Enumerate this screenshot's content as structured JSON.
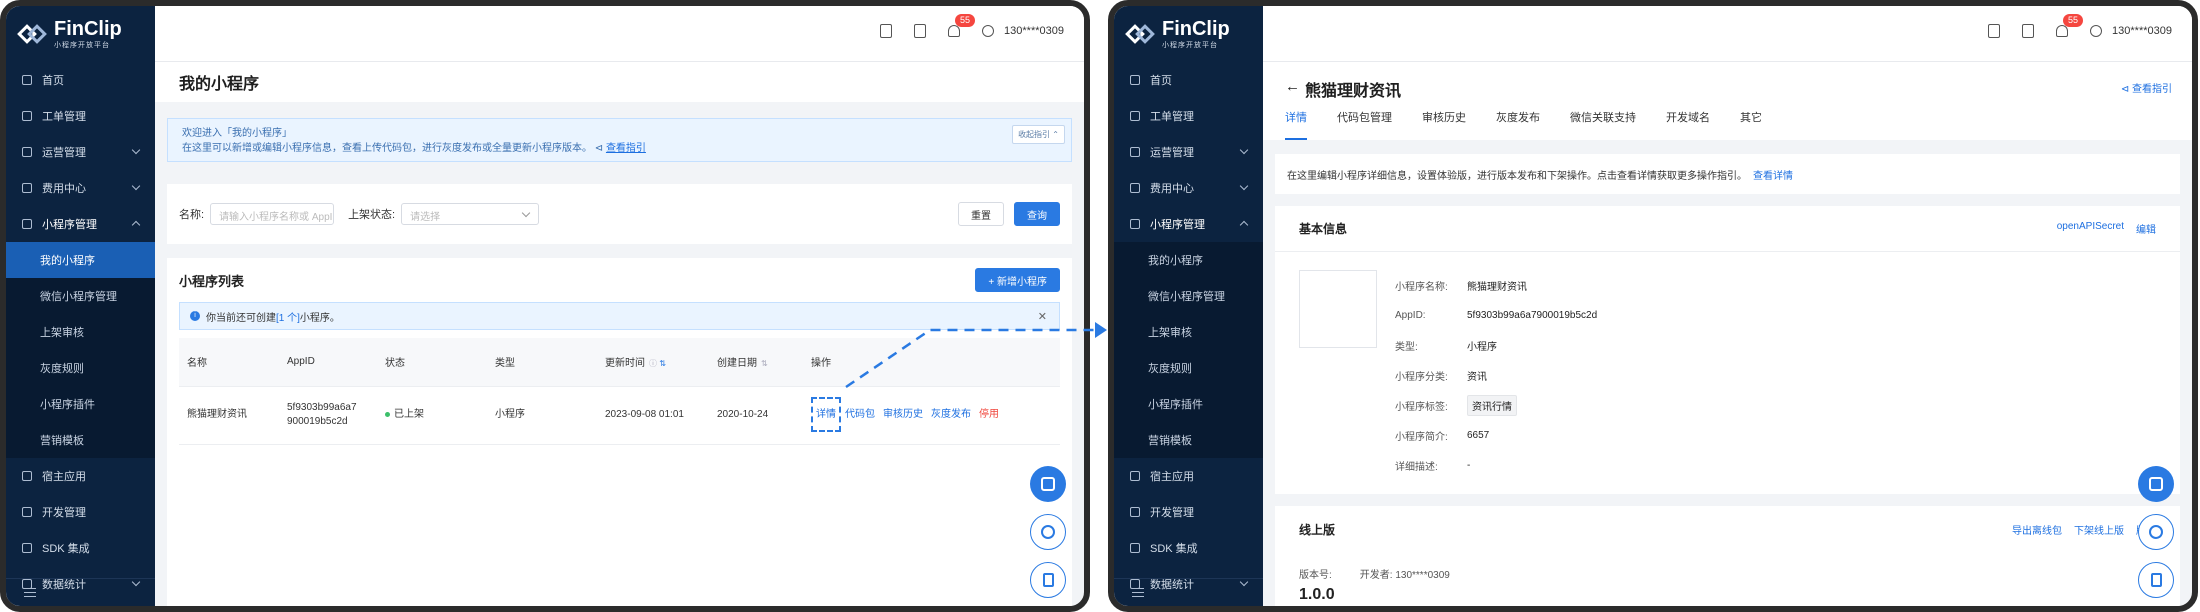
{
  "brand": {
    "title": "FinClip",
    "subtitle": "小程序开放平台"
  },
  "header": {
    "badge_count": "55",
    "user": "130****0309"
  },
  "sidebar": {
    "items": [
      {
        "label": "首页"
      },
      {
        "label": "工单管理"
      },
      {
        "label": "运营管理"
      },
      {
        "label": "费用中心"
      },
      {
        "label": "小程序管理"
      }
    ],
    "sub_items": [
      {
        "label": "我的小程序"
      },
      {
        "label": "微信小程序管理"
      },
      {
        "label": "上架审核"
      },
      {
        "label": "灰度规则"
      },
      {
        "label": "小程序插件"
      },
      {
        "label": "营销模板"
      }
    ],
    "bottom_items": [
      {
        "label": "宿主应用"
      },
      {
        "label": "开发管理"
      },
      {
        "label": "SDK 集成"
      },
      {
        "label": "数据统计"
      }
    ]
  },
  "left_page": {
    "title": "我的小程序",
    "alert_line1": "欢迎进入「我的小程序」",
    "alert_line2": "在这里可以新增或编辑小程序信息，查看上传代码包，进行灰度发布或全量更新小程序版本。",
    "alert_link": "查看指引",
    "collapse": "收起指引",
    "filter": {
      "name_label": "名称:",
      "name_placeholder": "请输入小程序名称或 AppID",
      "status_label": "上架状态:",
      "status_placeholder": "请选择",
      "reset": "重置",
      "query": "查询"
    },
    "list_title": "小程序列表",
    "add_button": "+ 新增小程序",
    "info_prefix": "你当前还可创建",
    "info_count": "[1 个]",
    "info_suffix": "小程序。",
    "columns": [
      "名称",
      "AppID",
      "状态",
      "类型",
      "更新时间",
      "创建日期",
      "操作"
    ],
    "row": {
      "name": "熊猫理财资讯",
      "appid_line1": "5f9303b99a6a7",
      "appid_line2": "900019b5c2d",
      "status": "已上架",
      "type": "小程序",
      "updated": "2023-09-08 01:01",
      "created": "2020-10-24",
      "ops": [
        "详情",
        "代码包",
        "审核历史",
        "灰度发布",
        "停用"
      ]
    }
  },
  "right_page": {
    "title": "熊猫理财资讯",
    "guide": "查看指引",
    "tabs": [
      "详情",
      "代码包管理",
      "审核历史",
      "灰度发布",
      "微信关联支持",
      "开发域名",
      "其它"
    ],
    "desc": "在这里编辑小程序详细信息，设置体验版，进行版本发布和下架操作。点击查看详情获取更多操作指引。",
    "desc_link": "查看详情",
    "basic": {
      "title": "基本信息",
      "actions": [
        "openAPISecret",
        "编辑"
      ],
      "fields": [
        {
          "label": "小程序名称:",
          "value": "熊猫理财资讯"
        },
        {
          "label": "AppID:",
          "value": "5f9303b99a6a7900019b5c2d"
        },
        {
          "label": "类型:",
          "value": "小程序"
        },
        {
          "label": "小程序分类:",
          "value": "资讯"
        },
        {
          "label": "小程序标签:",
          "value": "资讯行情"
        },
        {
          "label": "小程序简介:",
          "value": "6657"
        },
        {
          "label": "详细描述:",
          "value": "-"
        }
      ]
    },
    "online": {
      "title": "线上版",
      "actions": [
        "导出离线包",
        "下架线上版",
        "版本"
      ],
      "version_label": "版本号:",
      "developer_label": "开发者:",
      "developer": "130****0309",
      "version": "1.0.0"
    }
  }
}
